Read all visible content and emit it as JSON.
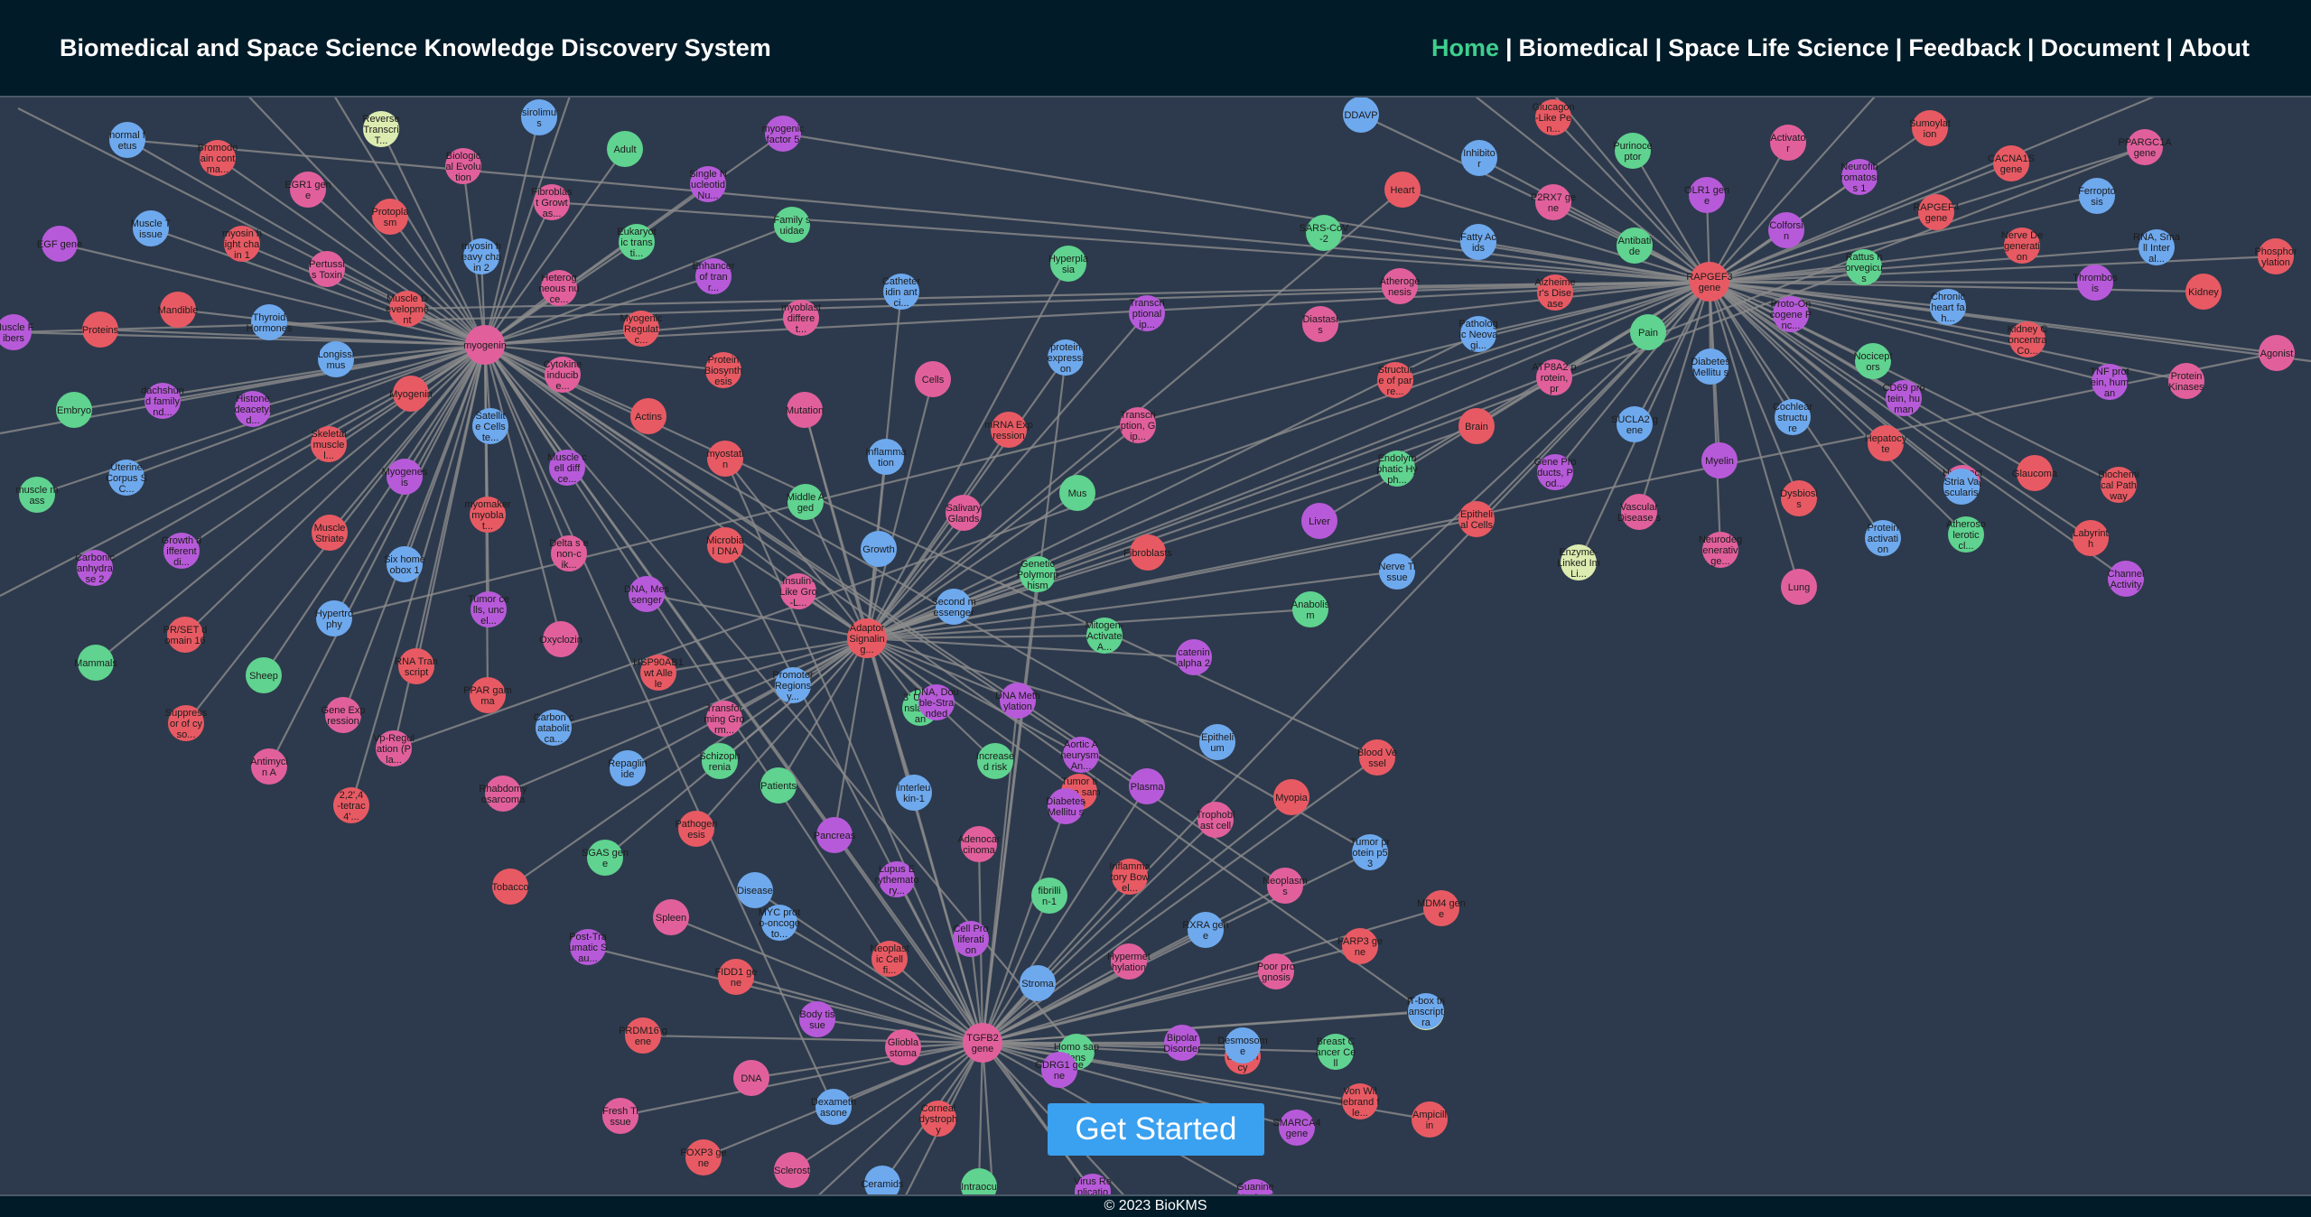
{
  "header": {
    "title": "Biomedical and Space Science Knowledge Discovery System",
    "nav": [
      {
        "label": "Home",
        "active": true
      },
      {
        "label": "Biomedical",
        "active": false
      },
      {
        "label": "Space Life Science",
        "active": false
      },
      {
        "label": "Feedback",
        "active": false
      },
      {
        "label": "Document",
        "active": false
      },
      {
        "label": "About",
        "active": false
      }
    ],
    "nav_separator": "|"
  },
  "colors": {
    "background": "#2d3a4d",
    "header_bg": "#021b28",
    "edge": "#8b8b8b",
    "active_nav": "#3ecf8e",
    "button": "#3aa0f0",
    "node_red": "#e85a63",
    "node_pink": "#e1609c",
    "node_purple": "#b75ad9",
    "node_blue": "#6ea9ee",
    "node_green": "#5fd38f",
    "node_pale": "#dcecb0"
  },
  "graph": {
    "hubs": [
      "myogenin",
      "RAPGEF3 gene",
      "Adaptor Signalin g...",
      "TGFB2 gene"
    ],
    "node_labels": [
      "normal f etus",
      "Bromodo ain cont ma...",
      "EGR1 gen e",
      "Reverse Transcri T...",
      "Biologic al Evolu tion",
      "sirolimu s",
      "Adult",
      "myogenic factor 5",
      "Single N ucleotid Nu...",
      "Family s uidae",
      "Muscle T issue",
      "myosin h ight cha in 1",
      "Pertussi s Toxin",
      "Protopla sm",
      "Fibroblas t Growt as...",
      "myosin h eavy cha in 2",
      "Eukaryot ic trans ti...",
      "Enhancer of tran r...",
      "EGF gene",
      "Mandible",
      "Thyroid Hormones",
      "Muscle D evelopme nt",
      "Heterog neous nu ce...",
      "Myogenic Regulat c...",
      "myoblast differe t...",
      "Catheter idin ant ci...",
      "Hyperpla sia",
      "Transcri ptional ip...",
      "Muscle F ibers",
      "Proteins",
      "Longissi mus",
      "Myogenin",
      "Cytokine inducib e...",
      "Protein Biosynth esis",
      "Cells",
      "protein expressi on",
      "Embryo",
      "dachshun d family nd...",
      "Histone deacetyl d...",
      "Skeletal muscle l...",
      "Satellit e Cells te...",
      "Actins",
      "Mutation",
      "mRNA Exp ression",
      "Transcri ption, G ip...",
      "Uterine Corpus S C...",
      "muscle m ass",
      "Myogenes is",
      "Muscle c ell diff ce...",
      "myostati n",
      "Inflamma tion",
      "Mus",
      "Middle A ged",
      "Fibroblasts",
      "Salivary Glands",
      "Growth",
      "Genetic Polymorp hism",
      "Carbonic anhydra se 2",
      "Growth d ifferent di...",
      "Muscle Striate",
      "Six home obox 1",
      "myomaker myobla t...",
      "Delta s e non-c ik...",
      "Microbia l DNA",
      "Insulin- Like Gro -L...",
      "Second m essenger",
      "Mitogen- Activate A...",
      "Tumor ce lls, unc el...",
      "DNA, Mes senger",
      "PR/SET d omain 16",
      "Hypertro phy",
      "RNA Tran script",
      "Oxyclozin",
      "HSP90AB1 wt Alle le",
      "Transfor ming Gro rm...",
      "Promoter Regions y...",
      "3' Untra nslated an",
      "DNA Meth ylation",
      "catenin alpha 2",
      "Mammals",
      "Sheep",
      "PPAR gam ma",
      "Gene Exp ression",
      "Suppress or of cy so...",
      "Vp-Regul ation (P la...",
      "Carbon c atabolit ca...",
      "Schizoph renia",
      "DNA, Dou ble-Stra nded",
      "Aortic A neurysm, An...",
      "Tumor ti ssue sam ple",
      "Epitheli um",
      "Blood Ve ssel",
      "Antimyci n A",
      "2,2',4 -tetrac 4'...",
      "Rhabdomy osarcoma",
      "Repaglin ide",
      "Increase d risk",
      "Diabetes Mellitu s",
      "Plasma",
      "Patients",
      "Interleu kin-1",
      "Pathogen esis",
      "Adenocar cinoma",
      "Myopia",
      "Trophobl ast cell",
      "Tumor pr otein p5 3",
      "SGAS gen e",
      "Pancreas",
      "Lupus E rythemato ry...",
      "Tobacco",
      "Disease",
      "Inflamma tory Bow el...",
      "Neoplasm s",
      "MDM4 gen e",
      "Spleen",
      "MYC prot o-oncoge to...",
      "fibrilli n-1",
      "Post-Tra umatic S au...",
      "Cell Pro liferati on",
      "Neoplast ic Cell fi...",
      "RXRA gen e",
      "FARP3 ge ne",
      "Poor pro gnosis",
      "FIDD1 ge ne",
      "Hypermet hylation",
      "Stroma",
      "Expressi on proce dure",
      "Body tis sue",
      "Bipolar Disorder",
      "Haploins ufficien cy",
      "T-box tr anscript ra",
      "PRDM16 g ene",
      "Gliobla stoma",
      "Homo sap iens",
      "DNA",
      "Desmosom e",
      "Breast C ancer Ce ll",
      "CDRG1 ge ne",
      "SMARCA4 gene",
      "Ampicill in",
      "Dexameth asone",
      "Corneal dystroph y",
      "Fresh Ti ssue",
      "FOXP3 ge ne",
      "Sclerost",
      "Ceramids",
      "Intraocu",
      "Virus Re plicatio n",
      "Guanine Nucleoti N...",
      "Von Wil lebrand f le...",
      "DDAVP",
      "Glucagon -Like Pe n...",
      "Activato r",
      "Sumoylat ion",
      "PPARGC1A gene",
      "Inhibito r",
      "Purinoce ptor",
      "OLR1 gen e",
      "Neurofib romatosi s 1",
      "CACNA1S gene",
      "Ferropto sis",
      "Heart",
      "P2RX7 ge ne",
      "RAPGEF4 gene",
      "SARS-CoV -2",
      "Fatty Ac ids",
      "Antibati de",
      "Colforsi n",
      "Rattus n orvegicu s",
      "Nerve De generati on",
      "RNA, Sma ll Inter al...",
      "Phosphor ylation",
      "Atheroge nesis",
      "Alzheime r's Dise ase",
      "Diastasi s",
      "Patholog ic Neova gi...",
      "Pain",
      "Proto-On cogene P nc...",
      "Thrombos is",
      "Kidney",
      "Chronic heart fa h...",
      "Kidney C oncentra Co...",
      "Agonist",
      "Structur e of par re...",
      "ATP8A2 p rotein, pr",
      "Diabetes Mellitu s",
      "Nocicept ors",
      "TNF prot ein, hum an",
      "CD69 pro tein, hu man",
      "Brain",
      "Cochlear structu re",
      "Hepatocy te",
      "Protein Kinases",
      "Glaucoma",
      "Hyperact ive beha vior",
      "SUCLA2 g ene",
      "Endolym phatic Hy ph...",
      "Myelin",
      "Gene Pro ducts, P od...",
      "Dysbiosi s",
      "Stria Va scularis",
      "Biochemi cal Path way",
      "Vascular Disease s",
      "Epitheli al Cells",
      "Neurodeg enerativ ge...",
      "Protein activati on",
      "Atheroso lerotic cl...",
      "Channel Activity",
      "Liver",
      "Anabolis m",
      "Nerve Ti ssue",
      "Enzyme- Linked Im Li...",
      "Lung",
      "Labyrint h"
    ]
  },
  "cta": {
    "label": "Get Started"
  },
  "footer": {
    "text": "© 2023 BioKMS"
  }
}
